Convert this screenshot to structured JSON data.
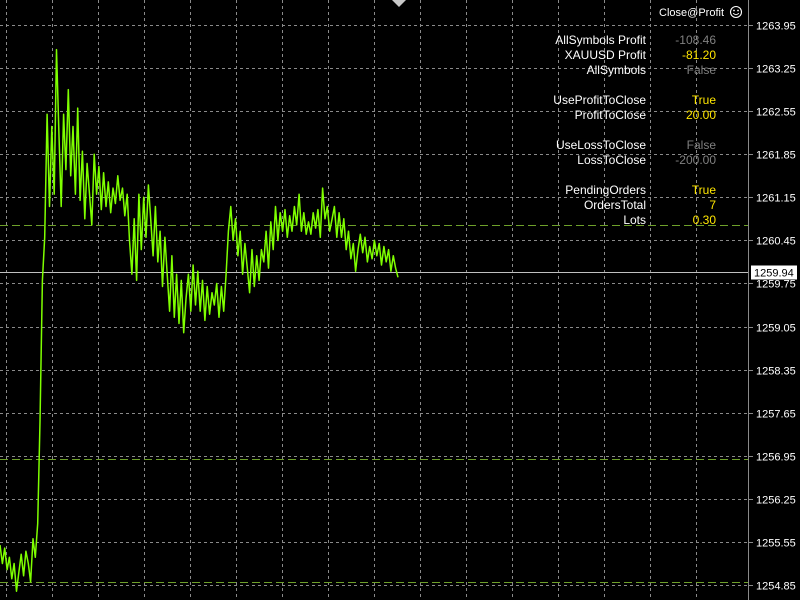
{
  "colors": {
    "background": "#000000",
    "grid": "#8a8a8a",
    "price_line": "#7fff00",
    "current_line": "#c0c0c0",
    "level_line": "#6ea02a",
    "label": "#ffffff",
    "value_yellow": "#ffe600",
    "value_gray": "#808080",
    "price_tag_bg": "#ffffff",
    "price_tag_text": "#000000"
  },
  "ea": {
    "title": "Close@Profit",
    "icon": "smiley-icon",
    "rows": [
      {
        "label": "AllSymbols Profit",
        "value": "-108.46",
        "tone": "gray"
      },
      {
        "label": "XAUUSD Profit",
        "value": "-81.20",
        "tone": "yellow"
      },
      {
        "label": "AllSymbols",
        "value": "False",
        "tone": "gray"
      },
      {
        "label": "UseProfitToClose",
        "value": "True",
        "tone": "yellow"
      },
      {
        "label": "ProfitToClose",
        "value": "20.00",
        "tone": "yellow"
      },
      {
        "label": "UseLossToClose",
        "value": "False",
        "tone": "gray"
      },
      {
        "label": "LossToClose",
        "value": "-200.00",
        "tone": "gray"
      },
      {
        "label": "PendingOrders",
        "value": "True",
        "tone": "yellow"
      },
      {
        "label": "OrdersTotal",
        "value": "7",
        "tone": "yellow"
      },
      {
        "label": "Lots",
        "value": "0.30",
        "tone": "yellow"
      }
    ]
  },
  "chart_data": {
    "type": "line",
    "title": "",
    "xlabel": "",
    "ylabel": "",
    "ylim": [
      1254.7,
      1264.12
    ],
    "y_ticks": [
      "1263.95",
      "1263.25",
      "1262.55",
      "1261.85",
      "1261.15",
      "1260.45",
      "1259.75",
      "1259.05",
      "1258.35",
      "1257.65",
      "1256.95",
      "1256.25",
      "1255.55",
      "1254.85"
    ],
    "current_price": "1259.94",
    "levels": [
      1260.7,
      1256.9,
      1254.9
    ],
    "grid": true,
    "series": [
      {
        "values": [
          1255.5,
          1255.2,
          1255.45,
          1255.1,
          1255.3,
          1254.95,
          1255.2,
          1254.75,
          1255.05,
          1255.35,
          1255.0,
          1255.4,
          1255.2,
          1254.9,
          1255.6,
          1255.3,
          1255.85,
          1257.5,
          1259.8,
          1260.5,
          1262.5,
          1261.0,
          1262.3,
          1261.2,
          1263.55,
          1262.2,
          1261.0,
          1262.5,
          1261.6,
          1262.9,
          1261.5,
          1262.3,
          1261.2,
          1262.6,
          1261.1,
          1261.9,
          1260.8,
          1261.7,
          1261.2,
          1260.7,
          1261.85,
          1261.2,
          1261.65,
          1260.95,
          1261.55,
          1261.0,
          1261.4,
          1260.9,
          1261.3,
          1261.05,
          1261.5,
          1261.1,
          1261.3,
          1260.85,
          1261.2,
          1260.45,
          1259.9,
          1260.8,
          1259.8,
          1261.2,
          1260.3,
          1261.15,
          1260.5,
          1261.35,
          1260.8,
          1260.2,
          1261.0,
          1260.1,
          1260.6,
          1259.7,
          1260.5,
          1259.9,
          1259.3,
          1260.2,
          1259.2,
          1259.9,
          1259.1,
          1259.8,
          1258.95,
          1259.5,
          1259.9,
          1259.3,
          1260.05,
          1259.4,
          1259.95,
          1259.3,
          1259.8,
          1259.15,
          1259.7,
          1259.25,
          1259.6,
          1259.4,
          1259.75,
          1259.2,
          1259.7,
          1259.3,
          1259.9,
          1260.6,
          1261.0,
          1260.45,
          1260.8,
          1260.2,
          1260.6,
          1259.9,
          1260.4,
          1260.0,
          1259.6,
          1260.3,
          1259.7,
          1260.2,
          1259.8,
          1260.3,
          1260.1,
          1260.6,
          1260.0,
          1260.75,
          1260.3,
          1261.0,
          1260.45,
          1260.9,
          1260.6,
          1260.95,
          1260.5,
          1260.85,
          1260.6,
          1261.0,
          1260.7,
          1261.2,
          1260.6,
          1260.9,
          1260.55,
          1260.75,
          1260.55,
          1260.9,
          1260.65,
          1260.95,
          1260.5,
          1261.3,
          1260.8,
          1261.0,
          1260.6,
          1260.8,
          1261.0,
          1260.5,
          1260.9,
          1260.5,
          1260.8,
          1260.3,
          1260.6,
          1260.15,
          1260.4,
          1259.95,
          1260.3,
          1260.55,
          1260.25,
          1260.5,
          1260.1,
          1260.35,
          1260.15,
          1260.45,
          1260.2,
          1260.4,
          1260.05,
          1260.35,
          1260.1,
          1260.3,
          1259.95,
          1260.2,
          1260.0,
          1259.85
        ]
      }
    ]
  }
}
